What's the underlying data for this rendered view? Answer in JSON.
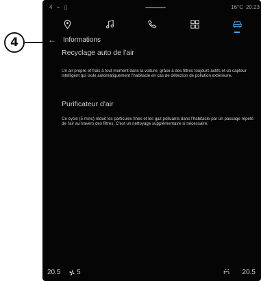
{
  "callout": {
    "label": "4"
  },
  "status_bar": {
    "signal": "4 ⌁ ▯",
    "temperature": "16°C",
    "time": "20:23"
  },
  "tabs": [
    {
      "name": "navigation",
      "icon": "location-pin-icon",
      "active": false
    },
    {
      "name": "music",
      "icon": "music-note-icon",
      "active": false
    },
    {
      "name": "phone",
      "icon": "phone-icon",
      "active": false
    },
    {
      "name": "apps",
      "icon": "apps-grid-icon",
      "active": false
    },
    {
      "name": "vehicle",
      "icon": "car-icon",
      "active": true
    }
  ],
  "header": {
    "back_icon": "back-arrow-icon",
    "title": "Informations"
  },
  "sections": [
    {
      "title": "Recyclage auto de l'air",
      "text": "Un air propre et frais à tout moment dans la voiture, grâce à des filtres toujours actifs et un capteur intelligent qui isole automatiquement l'habitacle en cas de détection de pollution extérieure."
    },
    {
      "title": "Purificateur d'air",
      "text": "Ce cycle (5 mins) réduit les particules fines et les gaz polluants dans l'habitacle par un passage répété de l'air au travers des filtres. C'est un nettoyage supplémentaire si nécessaire."
    }
  ],
  "bottom_bar": {
    "left_temp": "20.5",
    "fan_icon": "fan-icon",
    "fan_level": "5",
    "right_icon": "seat-heat-icon",
    "right_temp": "20.5"
  }
}
